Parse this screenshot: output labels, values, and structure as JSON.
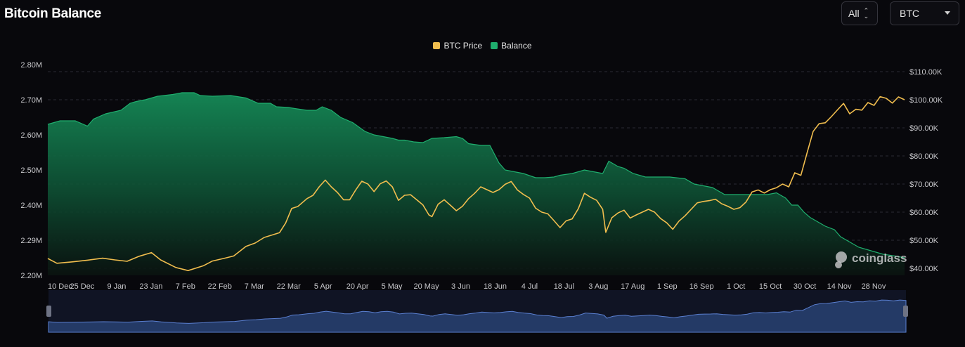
{
  "title": "Bitcoin Balance",
  "controls": {
    "range_label": "All",
    "asset_label": "BTC"
  },
  "watermark": "coinglass",
  "colors": {
    "btc_price": "#f0bd4e",
    "balance": "#1fae6e",
    "balance_fill_top": "#158a57",
    "navigator_fill": "#243a66"
  },
  "chart_data": {
    "type": "line",
    "legend_position": "top-center",
    "grid": true,
    "x_ticks": [
      "10 Dec",
      "25 Dec",
      "9 Jan",
      "23 Jan",
      "7 Feb",
      "22 Feb",
      "7 Mar",
      "22 Mar",
      "5 Apr",
      "20 Apr",
      "5 May",
      "20 May",
      "3 Jun",
      "18 Jun",
      "4 Jul",
      "18 Jul",
      "3 Aug",
      "17 Aug",
      "1 Sep",
      "16 Sep",
      "1 Oct",
      "15 Oct",
      "30 Oct",
      "14 Nov",
      "28 Nov"
    ],
    "y_left": {
      "ticks": [
        "2.20M",
        "2.29M",
        "2.40M",
        "2.50M",
        "2.60M",
        "2.70M",
        "2.80M"
      ],
      "tick_values": [
        2.2,
        2.3,
        2.4,
        2.5,
        2.6,
        2.7,
        2.8
      ],
      "range": [
        2.2,
        2.8
      ],
      "unit": "M"
    },
    "y_right": {
      "ticks": [
        "$40.00K",
        "$50.00K",
        "$60.00K",
        "$70.00K",
        "$80.00K",
        "$90.00K",
        "$100.00K",
        "$110.00K"
      ],
      "tick_values": [
        40,
        50,
        60,
        70,
        80,
        90,
        100,
        110
      ],
      "range": [
        37.5,
        112.5
      ],
      "unit": "K"
    },
    "series": [
      {
        "name": "BTC Price",
        "axis": "right",
        "chart": "line",
        "points": [
          [
            0,
            43.5
          ],
          [
            3,
            41.8
          ],
          [
            8,
            42.3
          ],
          [
            13,
            42.9
          ],
          [
            18,
            43.6
          ],
          [
            22,
            43.0
          ],
          [
            26,
            42.5
          ],
          [
            30,
            44.3
          ],
          [
            34,
            45.6
          ],
          [
            37,
            43.0
          ],
          [
            42,
            40.3
          ],
          [
            46,
            39.2
          ],
          [
            51,
            40.9
          ],
          [
            54,
            42.6
          ],
          [
            58,
            43.6
          ],
          [
            61,
            44.4
          ],
          [
            65,
            47.8
          ],
          [
            68,
            49.0
          ],
          [
            71,
            51.0
          ],
          [
            74,
            52.0
          ],
          [
            76,
            52.7
          ],
          [
            78,
            56.1
          ],
          [
            80,
            61.3
          ],
          [
            82,
            62.0
          ],
          [
            85,
            64.8
          ],
          [
            87,
            66.0
          ],
          [
            89,
            69.0
          ],
          [
            91,
            71.4
          ],
          [
            93,
            69.0
          ],
          [
            95,
            67.0
          ],
          [
            97,
            64.4
          ],
          [
            99,
            64.4
          ],
          [
            101,
            67.9
          ],
          [
            103,
            71.0
          ],
          [
            105,
            70.0
          ],
          [
            107,
            67.3
          ],
          [
            109,
            70.1
          ],
          [
            111,
            71.1
          ],
          [
            113,
            69.0
          ],
          [
            115,
            64.2
          ],
          [
            117,
            66.0
          ],
          [
            119,
            66.2
          ],
          [
            121,
            64.4
          ],
          [
            123,
            62.6
          ],
          [
            125,
            59.0
          ],
          [
            126,
            58.4
          ],
          [
            128,
            62.8
          ],
          [
            130,
            64.4
          ],
          [
            132,
            62.5
          ],
          [
            134,
            60.5
          ],
          [
            136,
            62.1
          ],
          [
            138,
            64.8
          ],
          [
            140,
            66.7
          ],
          [
            142,
            69.0
          ],
          [
            144,
            68.0
          ],
          [
            146,
            67.0
          ],
          [
            148,
            68.0
          ],
          [
            150,
            69.9
          ],
          [
            152,
            70.9
          ],
          [
            154,
            67.9
          ],
          [
            156,
            66.3
          ],
          [
            158,
            65.0
          ],
          [
            160,
            61.4
          ],
          [
            162,
            60.0
          ],
          [
            164,
            59.4
          ],
          [
            166,
            57.0
          ],
          [
            168,
            54.5
          ],
          [
            170,
            56.9
          ],
          [
            172,
            57.6
          ],
          [
            174,
            61.2
          ],
          [
            176,
            66.7
          ],
          [
            178,
            65.3
          ],
          [
            180,
            64.2
          ],
          [
            182,
            61.0
          ],
          [
            183,
            52.8
          ],
          [
            185,
            58.0
          ],
          [
            187,
            59.7
          ],
          [
            189,
            60.7
          ],
          [
            191,
            57.9
          ],
          [
            193,
            59.0
          ],
          [
            195,
            60.0
          ],
          [
            197,
            61.0
          ],
          [
            199,
            60.0
          ],
          [
            201,
            57.7
          ],
          [
            203,
            56.2
          ],
          [
            205,
            53.9
          ],
          [
            207,
            56.8
          ],
          [
            209,
            58.7
          ],
          [
            211,
            61.0
          ],
          [
            213,
            63.3
          ],
          [
            215,
            63.8
          ],
          [
            217,
            64.1
          ],
          [
            219,
            64.6
          ],
          [
            221,
            63.0
          ],
          [
            223,
            62.1
          ],
          [
            225,
            61.0
          ],
          [
            227,
            61.6
          ],
          [
            229,
            63.6
          ],
          [
            231,
            67.2
          ],
          [
            233,
            67.9
          ],
          [
            235,
            66.8
          ],
          [
            237,
            68.0
          ],
          [
            239,
            68.7
          ],
          [
            241,
            70.0
          ],
          [
            243,
            69.0
          ],
          [
            245,
            74.0
          ],
          [
            247,
            73.1
          ],
          [
            249,
            81.0
          ],
          [
            251,
            88.7
          ],
          [
            253,
            91.5
          ],
          [
            255,
            91.8
          ],
          [
            257,
            94.0
          ],
          [
            259,
            96.4
          ],
          [
            261,
            98.7
          ],
          [
            263,
            95.0
          ],
          [
            265,
            96.6
          ],
          [
            267,
            96.3
          ],
          [
            269,
            99.0
          ],
          [
            271,
            98.0
          ],
          [
            273,
            101.1
          ],
          [
            275,
            100.5
          ],
          [
            277,
            98.8
          ],
          [
            279,
            101.0
          ],
          [
            281,
            100.0
          ]
        ]
      },
      {
        "name": "Balance",
        "axis": "left",
        "chart": "area",
        "points": [
          [
            0,
            2.63
          ],
          [
            4,
            2.64
          ],
          [
            9,
            2.64
          ],
          [
            13,
            2.625
          ],
          [
            15,
            2.645
          ],
          [
            19,
            2.66
          ],
          [
            24,
            2.67
          ],
          [
            27,
            2.69
          ],
          [
            29,
            2.695
          ],
          [
            32,
            2.7
          ],
          [
            36,
            2.71
          ],
          [
            41,
            2.715
          ],
          [
            44,
            2.72
          ],
          [
            48,
            2.72
          ],
          [
            50,
            2.712
          ],
          [
            54,
            2.71
          ],
          [
            60,
            2.712
          ],
          [
            65,
            2.705
          ],
          [
            69,
            2.69
          ],
          [
            73,
            2.69
          ],
          [
            75,
            2.68
          ],
          [
            79,
            2.678
          ],
          [
            81,
            2.675
          ],
          [
            85,
            2.67
          ],
          [
            88,
            2.67
          ],
          [
            90,
            2.68
          ],
          [
            93,
            2.67
          ],
          [
            96,
            2.65
          ],
          [
            100,
            2.635
          ],
          [
            104,
            2.61
          ],
          [
            107,
            2.6
          ],
          [
            110,
            2.595
          ],
          [
            113,
            2.59
          ],
          [
            115,
            2.585
          ],
          [
            117,
            2.585
          ],
          [
            120,
            2.58
          ],
          [
            123,
            2.578
          ],
          [
            126,
            2.59
          ],
          [
            130,
            2.592
          ],
          [
            134,
            2.595
          ],
          [
            136,
            2.59
          ],
          [
            138,
            2.575
          ],
          [
            142,
            2.57
          ],
          [
            145,
            2.57
          ],
          [
            148,
            2.52
          ],
          [
            150,
            2.5
          ],
          [
            153,
            2.495
          ],
          [
            156,
            2.49
          ],
          [
            160,
            2.478
          ],
          [
            163,
            2.478
          ],
          [
            166,
            2.48
          ],
          [
            168,
            2.485
          ],
          [
            172,
            2.49
          ],
          [
            176,
            2.5
          ],
          [
            179,
            2.495
          ],
          [
            182,
            2.49
          ],
          [
            184,
            2.525
          ],
          [
            187,
            2.51
          ],
          [
            189,
            2.505
          ],
          [
            192,
            2.49
          ],
          [
            196,
            2.48
          ],
          [
            200,
            2.48
          ],
          [
            204,
            2.48
          ],
          [
            209,
            2.475
          ],
          [
            212,
            2.46
          ],
          [
            215,
            2.455
          ],
          [
            218,
            2.45
          ],
          [
            222,
            2.43
          ],
          [
            226,
            2.43
          ],
          [
            230,
            2.43
          ],
          [
            233,
            2.43
          ],
          [
            236,
            2.43
          ],
          [
            239,
            2.435
          ],
          [
            242,
            2.42
          ],
          [
            244,
            2.4
          ],
          [
            246,
            2.4
          ],
          [
            248,
            2.38
          ],
          [
            250,
            2.365
          ],
          [
            252,
            2.355
          ],
          [
            255,
            2.34
          ],
          [
            258,
            2.33
          ],
          [
            260,
            2.31
          ],
          [
            263,
            2.295
          ],
          [
            266,
            2.28
          ],
          [
            270,
            2.27
          ],
          [
            274,
            2.26
          ],
          [
            278,
            2.255
          ],
          [
            281,
            2.25
          ]
        ]
      }
    ]
  }
}
